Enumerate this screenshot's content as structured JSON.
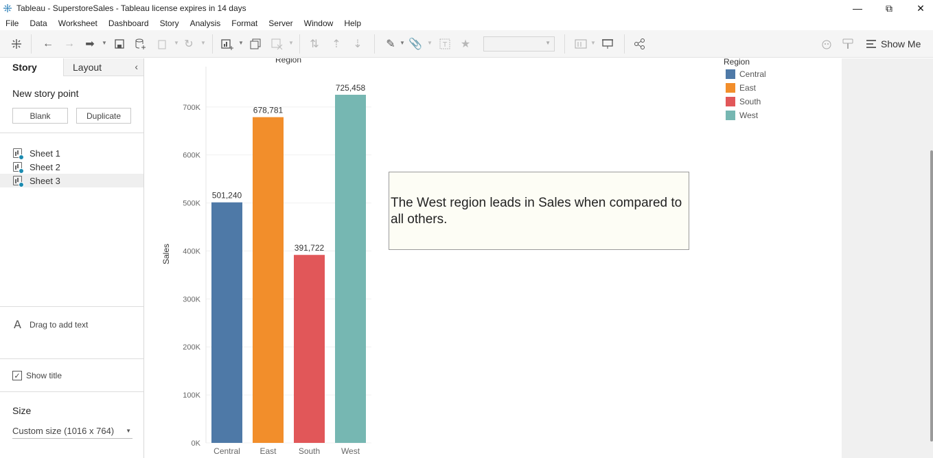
{
  "window": {
    "title": "Tableau - SuperstoreSales - Tableau license expires in 14 days",
    "minimize_glyph": "—",
    "restore_glyph": "⧉",
    "close_glyph": "✕"
  },
  "menu": [
    "File",
    "Data",
    "Worksheet",
    "Dashboard",
    "Story",
    "Analysis",
    "Format",
    "Server",
    "Window",
    "Help"
  ],
  "toolbar": {
    "show_me_label": "Show Me"
  },
  "left_panel": {
    "tabs": {
      "story": "Story",
      "layout": "Layout"
    },
    "new_story_point": "New story point",
    "blank_label": "Blank",
    "duplicate_label": "Duplicate",
    "sheets": [
      "Sheet 1",
      "Sheet 2",
      "Sheet 3"
    ],
    "selected_sheet": 2,
    "drag_text_icon": "A",
    "drag_text_label": "Drag to add text",
    "show_title_label": "Show title",
    "show_title_checked": true,
    "size_heading": "Size",
    "size_value": "Custom size (1016 x 764)"
  },
  "annotation_text": "The West region leads in Sales when compared to all others.",
  "legend": {
    "title": "Region",
    "items": [
      {
        "label": "Central",
        "color": "#4e79a7"
      },
      {
        "label": "East",
        "color": "#f28e2b"
      },
      {
        "label": "South",
        "color": "#e15759"
      },
      {
        "label": "West",
        "color": "#76b7b2"
      }
    ]
  },
  "chart_data": {
    "type": "bar",
    "title": "Region",
    "ylabel": "Sales",
    "xlabel": "",
    "categories": [
      "Central",
      "East",
      "South",
      "West"
    ],
    "values": [
      501240,
      678781,
      391722,
      725458
    ],
    "value_labels": [
      "501,240",
      "678,781",
      "391,722",
      "725,458"
    ],
    "colors": [
      "#4e79a7",
      "#f28e2b",
      "#e15759",
      "#76b7b2"
    ],
    "ylim": [
      0,
      725458
    ],
    "yticks": [
      0,
      100000,
      200000,
      300000,
      400000,
      500000,
      600000,
      700000
    ],
    "ytick_labels": [
      "0K",
      "100K",
      "200K",
      "300K",
      "400K",
      "500K",
      "600K",
      "700K"
    ],
    "grid": true
  }
}
